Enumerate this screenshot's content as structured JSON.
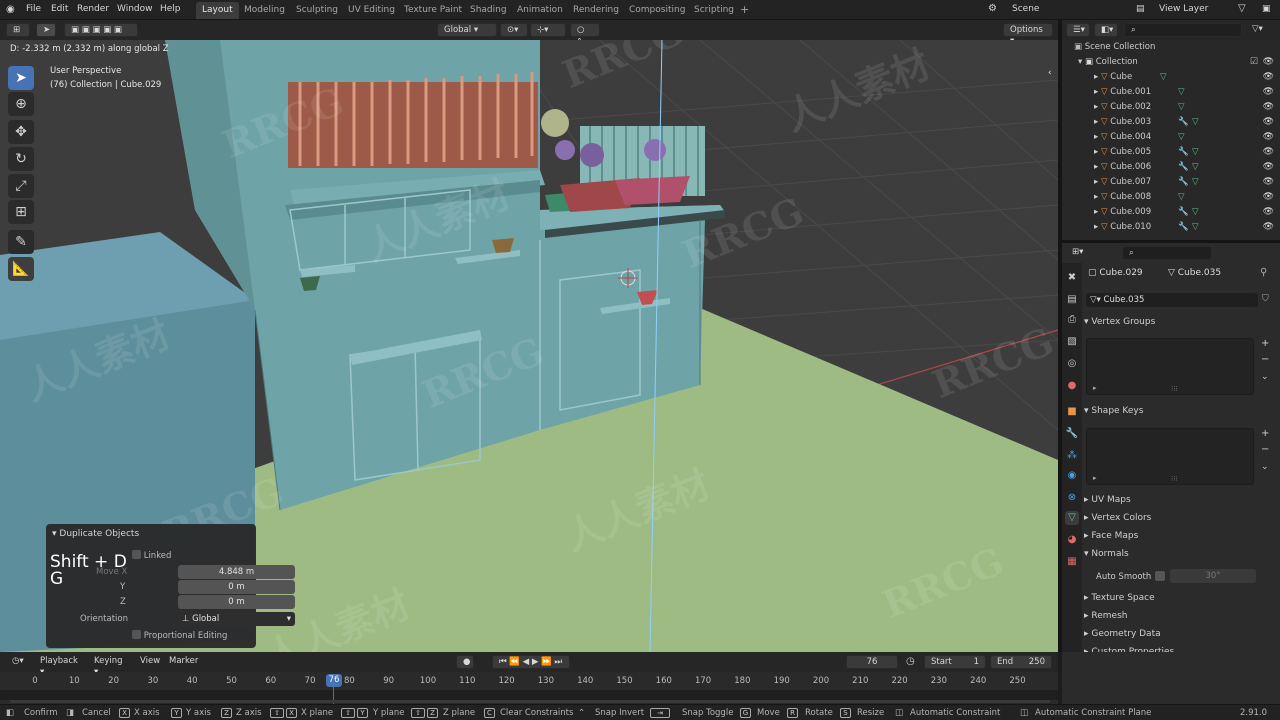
{
  "menus": [
    "File",
    "Edit",
    "Render",
    "Window",
    "Help"
  ],
  "workspaces": [
    "Layout",
    "Modeling",
    "Sculpting",
    "UV Editing",
    "Texture Paint",
    "Shading",
    "Animation",
    "Rendering",
    "Compositing",
    "Scripting"
  ],
  "workspace_add": "+",
  "scene": {
    "label": "Scene"
  },
  "view_layer": {
    "label": "View Layer"
  },
  "header": {
    "status_text": "D: -2.332 m (2.332 m) along global Z",
    "orientation": "Global",
    "options": "Options"
  },
  "viewport": {
    "perspective": "User Perspective",
    "collection_info": "(76) Collection | Cube.029"
  },
  "redo_panel": {
    "title": "Duplicate Objects",
    "linked": "Linked",
    "shortcut_line1": "Shift + D",
    "shortcut_line2": "G",
    "move_x_label": "Move X",
    "move_x": "4.848 m",
    "y_label": "Y",
    "y": "0 m",
    "z_label": "Z",
    "z": "0 m",
    "orientation_label": "Orientation",
    "orientation": "Global",
    "proportional": "Proportional Editing"
  },
  "outliner": {
    "scene_collection": "Scene Collection",
    "collection": "Collection",
    "items": [
      "Cube",
      "Cube.001",
      "Cube.002",
      "Cube.003",
      "Cube.004",
      "Cube.005",
      "Cube.006",
      "Cube.007",
      "Cube.008",
      "Cube.009",
      "Cube.010"
    ]
  },
  "properties": {
    "object_name": "Cube.029",
    "mesh_name": "Cube.035",
    "mesh_field": "Cube.035",
    "sections": {
      "vertex_groups": "Vertex Groups",
      "shape_keys": "Shape Keys",
      "uv_maps": "UV Maps",
      "vertex_colors": "Vertex Colors",
      "face_maps": "Face Maps",
      "normals": "Normals",
      "auto_smooth": "Auto Smooth",
      "auto_smooth_angle": "30°",
      "texture_space": "Texture Space",
      "remesh": "Remesh",
      "geometry_data": "Geometry Data",
      "custom_properties": "Custom Properties"
    }
  },
  "timeline": {
    "playback": "Playback",
    "keying": "Keying",
    "view": "View",
    "marker": "Marker",
    "current_frame": "76",
    "start_label": "Start",
    "start": "1",
    "end_label": "End",
    "end": "250",
    "ticks": [
      "0",
      "10",
      "20",
      "30",
      "40",
      "50",
      "60",
      "70",
      "80",
      "90",
      "100",
      "110",
      "120",
      "130",
      "140",
      "150",
      "160",
      "170",
      "180",
      "190",
      "200",
      "210",
      "220",
      "230",
      "240",
      "250"
    ],
    "playhead": "76"
  },
  "statusbar": {
    "confirm": "Confirm",
    "cancel": "Cancel",
    "x_axis": "X axis",
    "y_axis": "Y axis",
    "z_axis": "Z axis",
    "x_plane": "X plane",
    "y_plane": "Y plane",
    "z_plane": "Z plane",
    "clear_constraints": "Clear Constraints",
    "snap_invert": "Snap Invert",
    "snap_toggle": "Snap Toggle",
    "move": "Move",
    "rotate": "Rotate",
    "resize": "Resize",
    "auto_constraint": "Automatic Constraint",
    "auto_constraint_plane": "Automatic Constraint Plane",
    "version": "2.91.0"
  },
  "watermarks": [
    "RRCG",
    "人人素材",
    "RRCG",
    "人人素材",
    "RRCG",
    "RRCG",
    "人人素材",
    "RRCG",
    "人人素材",
    "RRCG",
    "人人素材",
    "RRCG"
  ],
  "colors": {
    "accent": "#4772b3",
    "ground": "#9dbb82",
    "building": "#6ea3a8"
  }
}
